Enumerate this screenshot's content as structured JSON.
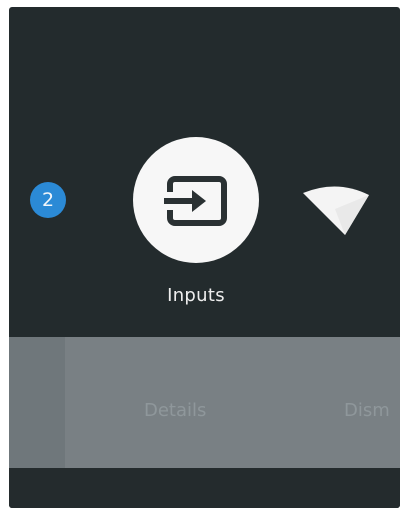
{
  "quick_settings": {
    "notification_badge": "2",
    "inputs_label": "Inputs",
    "inputs_icon": "input-source-icon",
    "network_icon": "wifi-icon"
  },
  "actions": {
    "details": "Details",
    "dismiss": "Dism"
  },
  "colors": {
    "background": "#232b2d",
    "badge": "#2b8ad6",
    "selected_circle": "#f7f7f7",
    "action_bar": "#798084"
  }
}
